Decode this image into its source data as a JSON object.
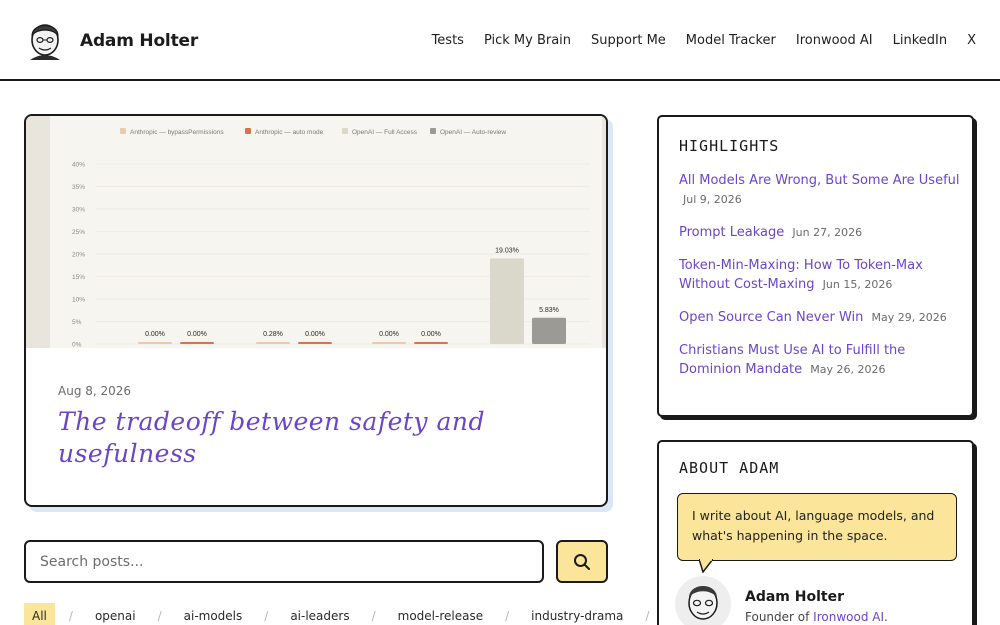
{
  "site": {
    "title": "Adam Holter",
    "nav": [
      "Tests",
      "Pick My Brain",
      "Support Me",
      "Model Tracker",
      "Ironwood AI",
      "LinkedIn",
      "X"
    ]
  },
  "featured": {
    "date": "Aug 8, 2026",
    "title": "The tradeoff between safety and usefulness"
  },
  "chart_data": {
    "type": "bar",
    "series": [
      {
        "name": "Anthropic — bypassPermissions",
        "color": "#eacaae"
      },
      {
        "name": "Anthropic — auto mode",
        "color": "#d9734d"
      },
      {
        "name": "OpenAI — Full Access",
        "color": "#dad7cb"
      },
      {
        "name": "OpenAI — Auto-review",
        "color": "#9c9a94"
      }
    ],
    "bars": [
      {
        "series": 0,
        "value": 0.0,
        "label": "0.00%"
      },
      {
        "series": 1,
        "value": 0.0,
        "label": "0.00%"
      },
      {
        "series": 0,
        "value": 0.28,
        "label": "0.28%"
      },
      {
        "series": 1,
        "value": 0.0,
        "label": "0.00%"
      },
      {
        "series": 0,
        "value": 0.0,
        "label": "0.00%"
      },
      {
        "series": 1,
        "value": 0.0,
        "label": "0.00%"
      },
      {
        "series": 2,
        "value": 19.03,
        "label": "19.03%"
      },
      {
        "series": 3,
        "value": 5.83,
        "label": "5.83%"
      }
    ],
    "yticks": [
      "40%",
      "35%",
      "30%",
      "25%",
      "20%",
      "15%",
      "10%",
      "5%",
      "0%"
    ],
    "ylim": [
      0,
      40
    ]
  },
  "search": {
    "placeholder": "Search posts..."
  },
  "tags": [
    "All",
    "openai",
    "ai-models",
    "ai-leaders",
    "model-release",
    "industry-drama"
  ],
  "highlights": {
    "title": "HIGHLIGHTS",
    "items": [
      {
        "title": "All Models Are Wrong, But Some Are Useful",
        "date": "Jul 9, 2026"
      },
      {
        "title": "Prompt Leakage",
        "date": "Jun 27, 2026"
      },
      {
        "title": "Token-Min-Maxing: How To Token-Max Without Cost-Maxing",
        "date": "Jun 15, 2026"
      },
      {
        "title": "Open Source Can Never Win",
        "date": "May 29, 2026"
      },
      {
        "title": "Christians Must Use AI to Fulfill the Dominion Mandate",
        "date": "May 26, 2026"
      }
    ]
  },
  "about": {
    "title": "ABOUT ADAM",
    "bubble": "I write about AI, language models, and what's happening in the space.",
    "name": "Adam Holter",
    "role_prefix": "Founder of",
    "role_link": "Ironwood AI",
    "role_suffix": "."
  }
}
